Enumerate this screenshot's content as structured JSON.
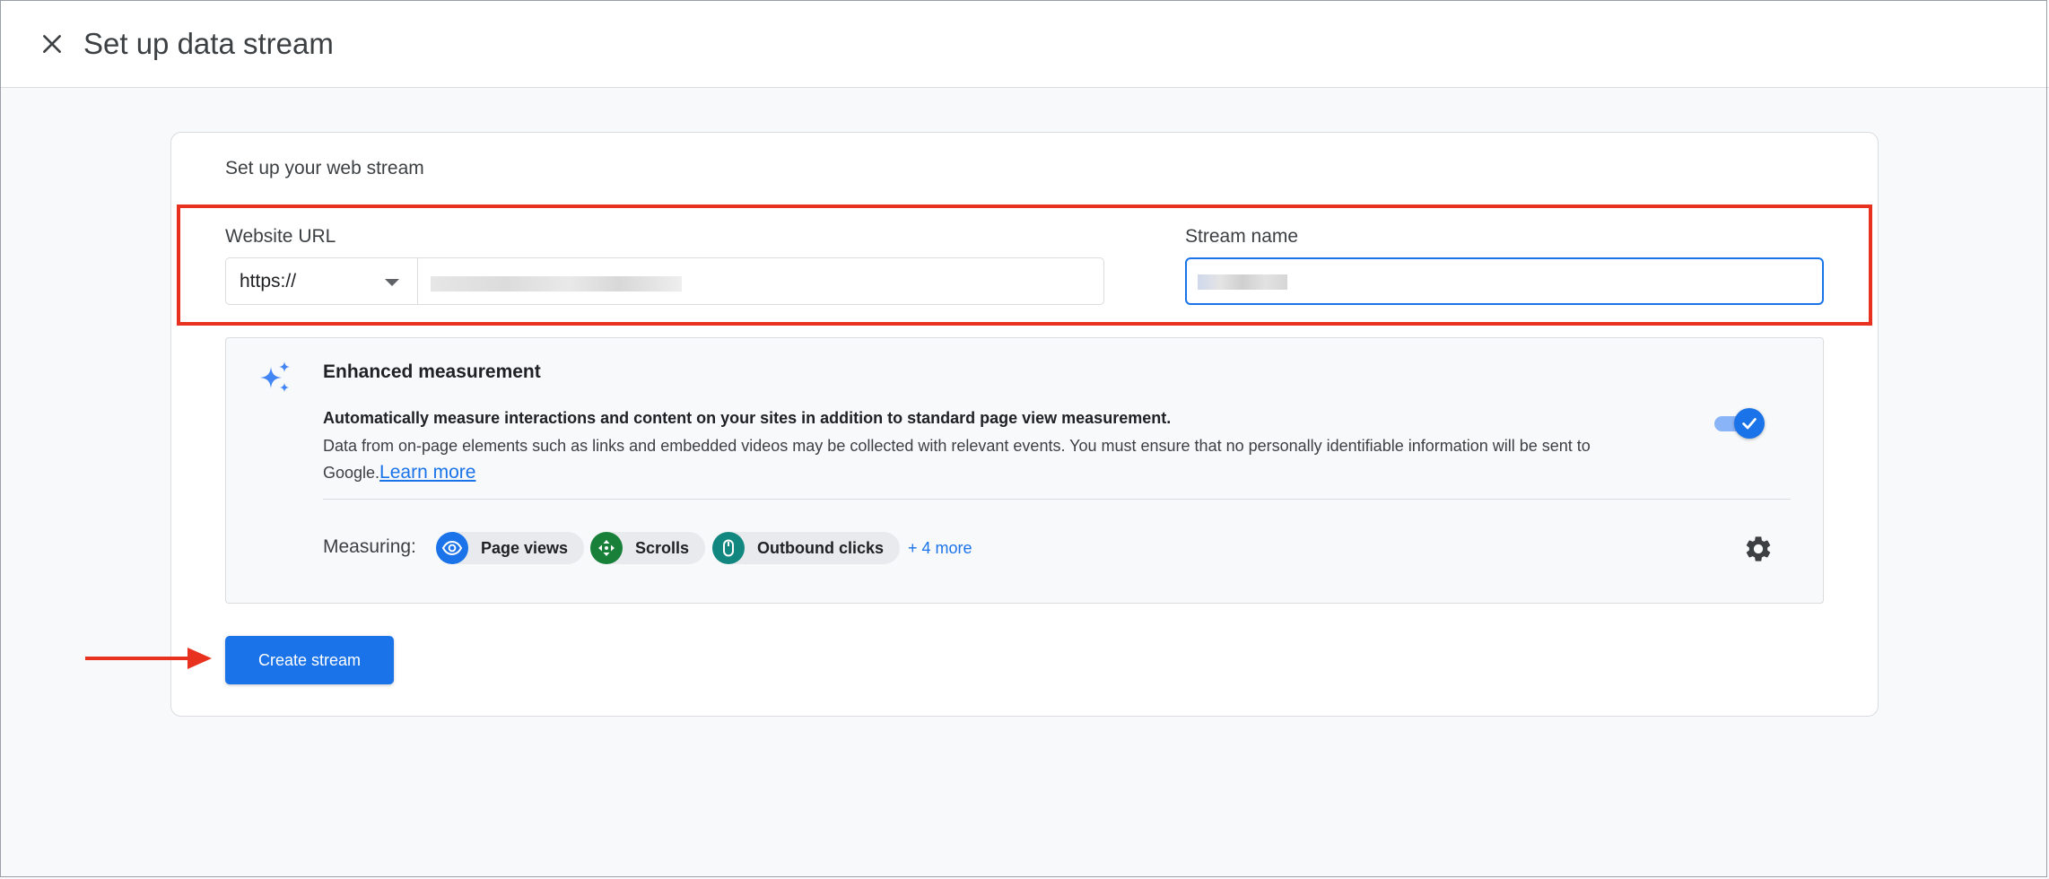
{
  "header": {
    "title": "Set up data stream",
    "close_icon": "close-icon"
  },
  "card": {
    "heading": "Set up your web stream"
  },
  "form": {
    "website_url_label": "Website URL",
    "protocol_value": "https://",
    "protocol_options": [
      "https://"
    ],
    "stream_name_label": "Stream name"
  },
  "enhanced_measurement": {
    "title": "Enhanced measurement",
    "description_bold": "Automatically measure interactions and content on your sites in addition to standard page view measurement.",
    "description": "Data from on-page elements such as links and embedded videos may be collected with relevant events. You must ensure that no personally identifiable information will be sent to Google.",
    "learn_more": "Learn more",
    "toggle_on": true,
    "measuring_label": "Measuring:",
    "chips": [
      {
        "label": "Page views",
        "icon": "eye-icon",
        "color": "#1a73e8"
      },
      {
        "label": "Scrolls",
        "icon": "scroll-arrows-icon",
        "color": "#188038"
      },
      {
        "label": "Outbound clicks",
        "icon": "mouse-icon",
        "color": "#12877f"
      }
    ],
    "more_link": "+ 4 more",
    "settings_icon": "gear-icon"
  },
  "actions": {
    "create_label": "Create stream"
  },
  "colors": {
    "accent": "#1a73e8",
    "highlight": "#e8321f",
    "panel_bg": "#f8f9fa"
  }
}
